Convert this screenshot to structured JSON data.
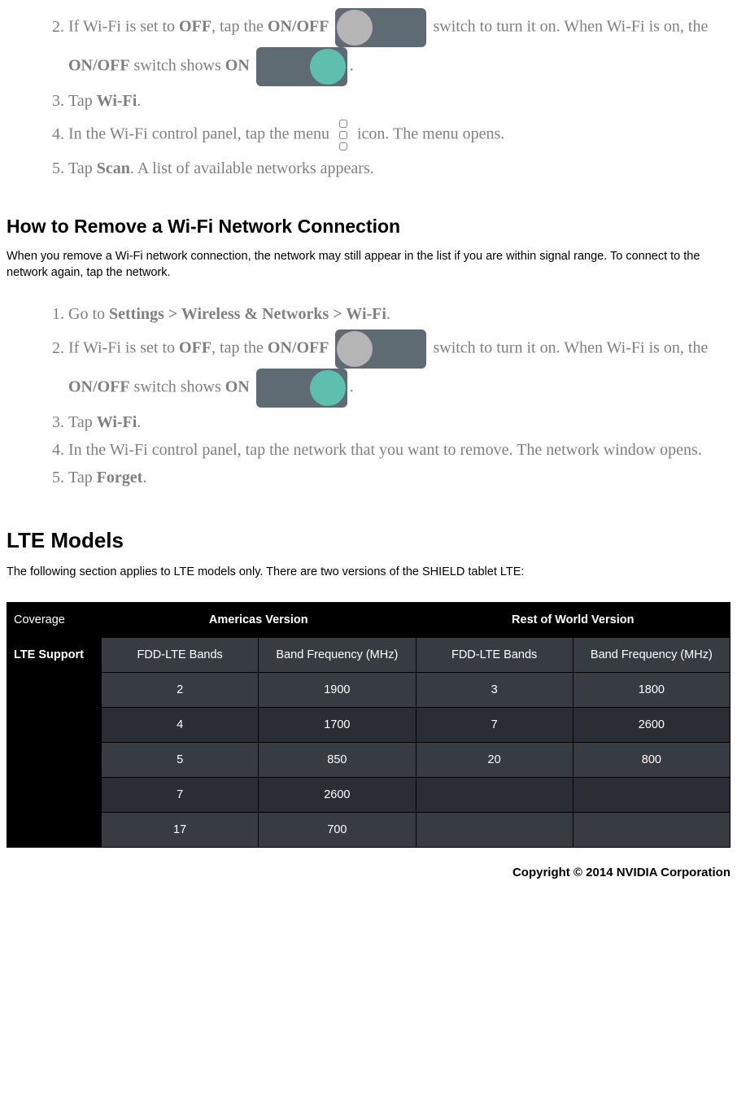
{
  "list1": {
    "start": 2,
    "items": [
      {
        "pre": "If Wi-Fi is set to ",
        "b1": "OFF",
        "mid1": ", tap the ",
        "b2": "ON/OFF",
        "aftertoggleoff": " switch to turn it on. When Wi-Fi is on, the ",
        "b3": "ON/OFF",
        "mid3": " switch shows ",
        "b4": "ON",
        "end": "."
      },
      {
        "pre": "Tap ",
        "b1": "Wi-Fi",
        "end": "."
      },
      {
        "pre": "In the Wi-Fi control panel, tap the menu ",
        "end": " icon. The menu opens."
      },
      {
        "pre": "Tap ",
        "b1": "Scan",
        "end": ". A list of available networks appears."
      }
    ]
  },
  "section2": {
    "title": "How to Remove a Wi-Fi Network Connection",
    "intro": "When you remove a Wi-Fi network connection, the network may still appear in the list if you are within signal range. To connect to the network again, tap the network."
  },
  "list2": {
    "items": [
      {
        "pre": "Go to ",
        "b1": "Settings > Wireless & Networks > Wi-Fi",
        "end": "."
      },
      {
        "pre": "If Wi-Fi is set to ",
        "b1": "OFF",
        "mid1": ", tap the ",
        "b2": "ON/OFF",
        "aftertoggleoff": " switch to turn it on. When Wi-Fi is on, the ",
        "b3": "ON/OFF",
        "mid3": " switch shows ",
        "b4": "ON",
        "end": "."
      },
      {
        "pre": "Tap ",
        "b1": "Wi-Fi",
        "end": "."
      },
      {
        "text": "In the Wi-Fi control panel, tap the network that you want to remove. The network window opens."
      },
      {
        "pre": "Tap ",
        "b1": "Forget",
        "end": "."
      }
    ]
  },
  "section3": {
    "title": "LTE Models",
    "intro": "The following section applies to LTE models only.  There are two versions of the SHIELD tablet LTE:"
  },
  "table": {
    "headers": {
      "coverage": "Coverage",
      "americas": "Americas Version",
      "row": "Rest of World Version",
      "lte_support": "LTE Support",
      "bands": "FDD-LTE Bands",
      "freq": "Band Frequency (MHz)"
    },
    "rows": [
      {
        "a_band": "2",
        "a_freq": "1900",
        "r_band": "3",
        "r_freq": "1800"
      },
      {
        "a_band": "4",
        "a_freq": "1700",
        "r_band": "7",
        "r_freq": "2600"
      },
      {
        "a_band": "5",
        "a_freq": "850",
        "r_band": "20",
        "r_freq": "800"
      },
      {
        "a_band": "7",
        "a_freq": "2600",
        "r_band": "",
        "r_freq": ""
      },
      {
        "a_band": "17",
        "a_freq": "700",
        "r_band": "",
        "r_freq": ""
      }
    ]
  },
  "copyright": "Copyright © 2014 NVIDIA Corporation"
}
